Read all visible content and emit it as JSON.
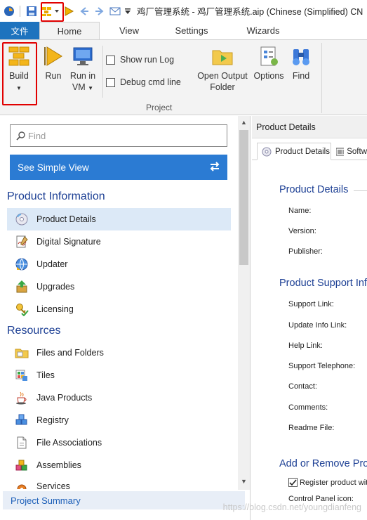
{
  "titlebar": {
    "title": "鸡厂管理系统 - 鸡厂管理系统.aip (Chinese (Simplified) CN"
  },
  "ribbon_tabs": {
    "file": "文件",
    "home": "Home",
    "view": "View",
    "settings": "Settings",
    "wizards": "Wizards"
  },
  "ribbon": {
    "build": "Build",
    "run": "Run",
    "run_in": "Run in",
    "vm": "VM",
    "show_run_log": "Show run Log",
    "debug_cmd_line": "Debug cmd line",
    "open_output": "Open Output",
    "folder": "Folder",
    "options": "Options",
    "find": "Find",
    "group_project": "Project"
  },
  "left": {
    "search_placeholder": "Find",
    "simple_view": "See Simple View",
    "product_info_title": "Product Information",
    "product_info_items": [
      "Product Details",
      "Digital Signature",
      "Updater",
      "Upgrades",
      "Licensing"
    ],
    "resources_title": "Resources",
    "resources_items": [
      "Files and Folders",
      "Tiles",
      "Java Products",
      "Registry",
      "File Associations",
      "Assemblies",
      "Services"
    ],
    "project_summary": "Project Summary"
  },
  "right": {
    "header": "Product Details",
    "tab_product_details": "Product Details",
    "tab_software": "Softw",
    "section_product_details": "Product Details",
    "fields_1": [
      "Name:",
      "Version:",
      "Publisher:"
    ],
    "section_support": "Product Support Inf",
    "fields_2": [
      "Support Link:",
      "Update Info Link:",
      "Help Link:",
      "Support Telephone:",
      "Contact:",
      "Comments:",
      "Readme File:"
    ],
    "section_add_remove": "Add or Remove Pro",
    "register_product": "Register product wit",
    "control_panel_icon": "Control Panel icon:"
  },
  "watermark": "https://blog.csdn.net/youngdianfeng",
  "colors": {
    "accent": "#1e73be",
    "section_title": "#1c3f94",
    "highlight_box": "#e10000",
    "selected_item": "#dce9f7"
  }
}
